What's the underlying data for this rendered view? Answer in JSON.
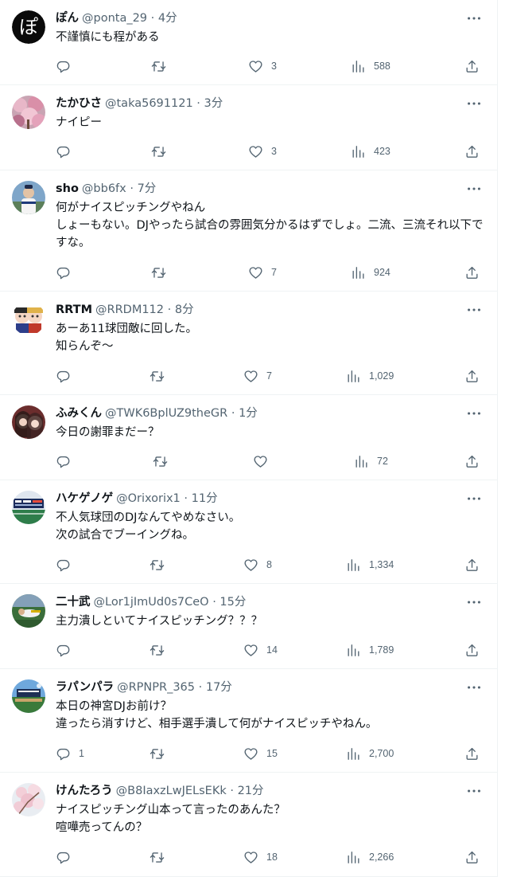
{
  "colors": {
    "text": "#0f1419",
    "secondary": "#536471",
    "divider": "#eff3f4",
    "background": "#ffffff"
  },
  "icons": [
    "reply-icon",
    "retweet-icon",
    "like-icon",
    "views-icon",
    "share-icon",
    "more-icon"
  ],
  "tweets": [
    {
      "avatar_letter": "ぽ",
      "name": "ぽん",
      "handle": "@ponta_29",
      "sep": "·",
      "time": "4分",
      "text": "不謹慎にも程がある",
      "replies": "",
      "retweets": "",
      "likes": "3",
      "views": "588"
    },
    {
      "name": "たかひさ",
      "handle": "@taka5691121",
      "sep": "·",
      "time": "3分",
      "text": "ナイピー",
      "replies": "",
      "retweets": "",
      "likes": "3",
      "views": "423"
    },
    {
      "name": "sho",
      "handle": "@bb6fx",
      "sep": "·",
      "time": "7分",
      "text": "何がナイスピッチングやねん\nしょーもない。DJやったら試合の雰囲気分かるはずでしょ。二流、三流それ以下ですな。",
      "replies": "",
      "retweets": "",
      "likes": "7",
      "views": "924"
    },
    {
      "name": "RRTM",
      "handle": "@RRDM112",
      "sep": "·",
      "time": "8分",
      "text": "あーあ11球団敵に回した。\n知らんぞ～",
      "replies": "",
      "retweets": "",
      "likes": "7",
      "views": "1,029"
    },
    {
      "name": "ふみくん",
      "handle": "@TWK6BplUZ9theGR",
      "sep": "·",
      "time": "1分",
      "text": "今日の謝罪まだー？",
      "replies": "",
      "retweets": "",
      "likes": "",
      "views": "72"
    },
    {
      "name": "ハケゲノゲ",
      "handle": "@Orixorix1",
      "sep": "·",
      "time": "11分",
      "text": "不人気球団のDJなんてやめなさい。\n次の試合でブーイングね。",
      "replies": "",
      "retweets": "",
      "likes": "8",
      "views": "1,334"
    },
    {
      "name": "二十武",
      "handle": "@Lor1jImUd0s7CeO",
      "sep": "·",
      "time": "15分",
      "text": "主力潰しといてナイスピッチング？？？",
      "replies": "",
      "retweets": "",
      "likes": "14",
      "views": "1,789"
    },
    {
      "name": "ラパンパラ",
      "handle": "@RPNPR_365",
      "sep": "·",
      "time": "17分",
      "text": "本日の神宮DJお前け？\n違ったら消すけど、相手選手潰して何がナイスピッチやねん。",
      "replies": "1",
      "retweets": "",
      "likes": "15",
      "views": "2,700"
    },
    {
      "name": "けんたろう",
      "handle": "@B8IaxzLwJELsEKk",
      "sep": "·",
      "time": "21分",
      "text": "ナイスピッチング山本って言ったのあんた？\n喧嘩売ってんの？",
      "replies": "",
      "retweets": "",
      "likes": "18",
      "views": "2,266"
    }
  ]
}
